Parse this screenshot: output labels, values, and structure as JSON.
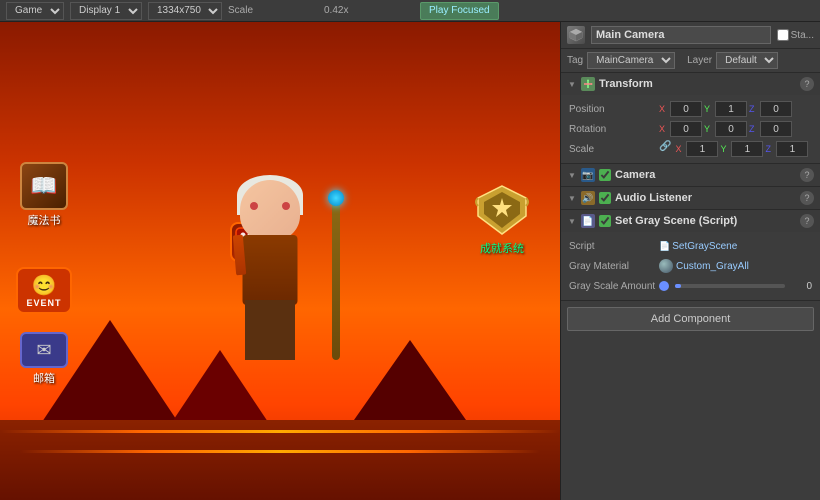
{
  "toolbar": {
    "game_label": "Game",
    "display_label": "Display 1",
    "resolution": "1334x750",
    "scale_label": "Scale",
    "scale_value": "0.42x",
    "play_focused": "Play Focused"
  },
  "viewport": {
    "magic_book_label": "魔法书",
    "achievement_label": "成就系统",
    "event_label": "EVENT",
    "mail_label": "邮箱"
  },
  "inspector": {
    "title": "Main Camera",
    "static_label": "Sta...",
    "tag_label": "Tag",
    "tag_value": "MainCamera",
    "layer_label": "Layer",
    "layer_value": "Default",
    "transform": {
      "name": "Transform",
      "position_label": "Position",
      "pos_x": "0",
      "pos_y": "1",
      "pos_z": "",
      "rotation_label": "Rotation",
      "rot_x": "0",
      "rot_y": "0",
      "rot_z": "",
      "scale_label": "Scale",
      "sc_x": "1",
      "sc_y": "1",
      "sc_z": ""
    },
    "camera": {
      "name": "Camera"
    },
    "audio_listener": {
      "name": "Audio Listener"
    },
    "gray_script": {
      "name": "Set Gray Scene (Script)",
      "script_label": "Script",
      "script_value": "SetGrayScene",
      "material_label": "Gray Material",
      "material_value": "Custom_GrayAll",
      "slider_label": "Gray Scale Amount",
      "slider_value": "0"
    },
    "add_component_label": "Add Component"
  },
  "icons": {
    "cube": "⬛",
    "arrow_down": "▼",
    "arrow_right": "▶",
    "help": "?",
    "link": "🔗",
    "camera": "📷",
    "audio": "🔊",
    "script": "📄",
    "check": "✓",
    "lock": "🔒",
    "mail": "✉",
    "book": "📖",
    "dice": "🎲"
  },
  "colors": {
    "accent": "#4a9eff",
    "green": "#4caf50",
    "orange": "#ff8c00",
    "script_color": "#9cf"
  }
}
